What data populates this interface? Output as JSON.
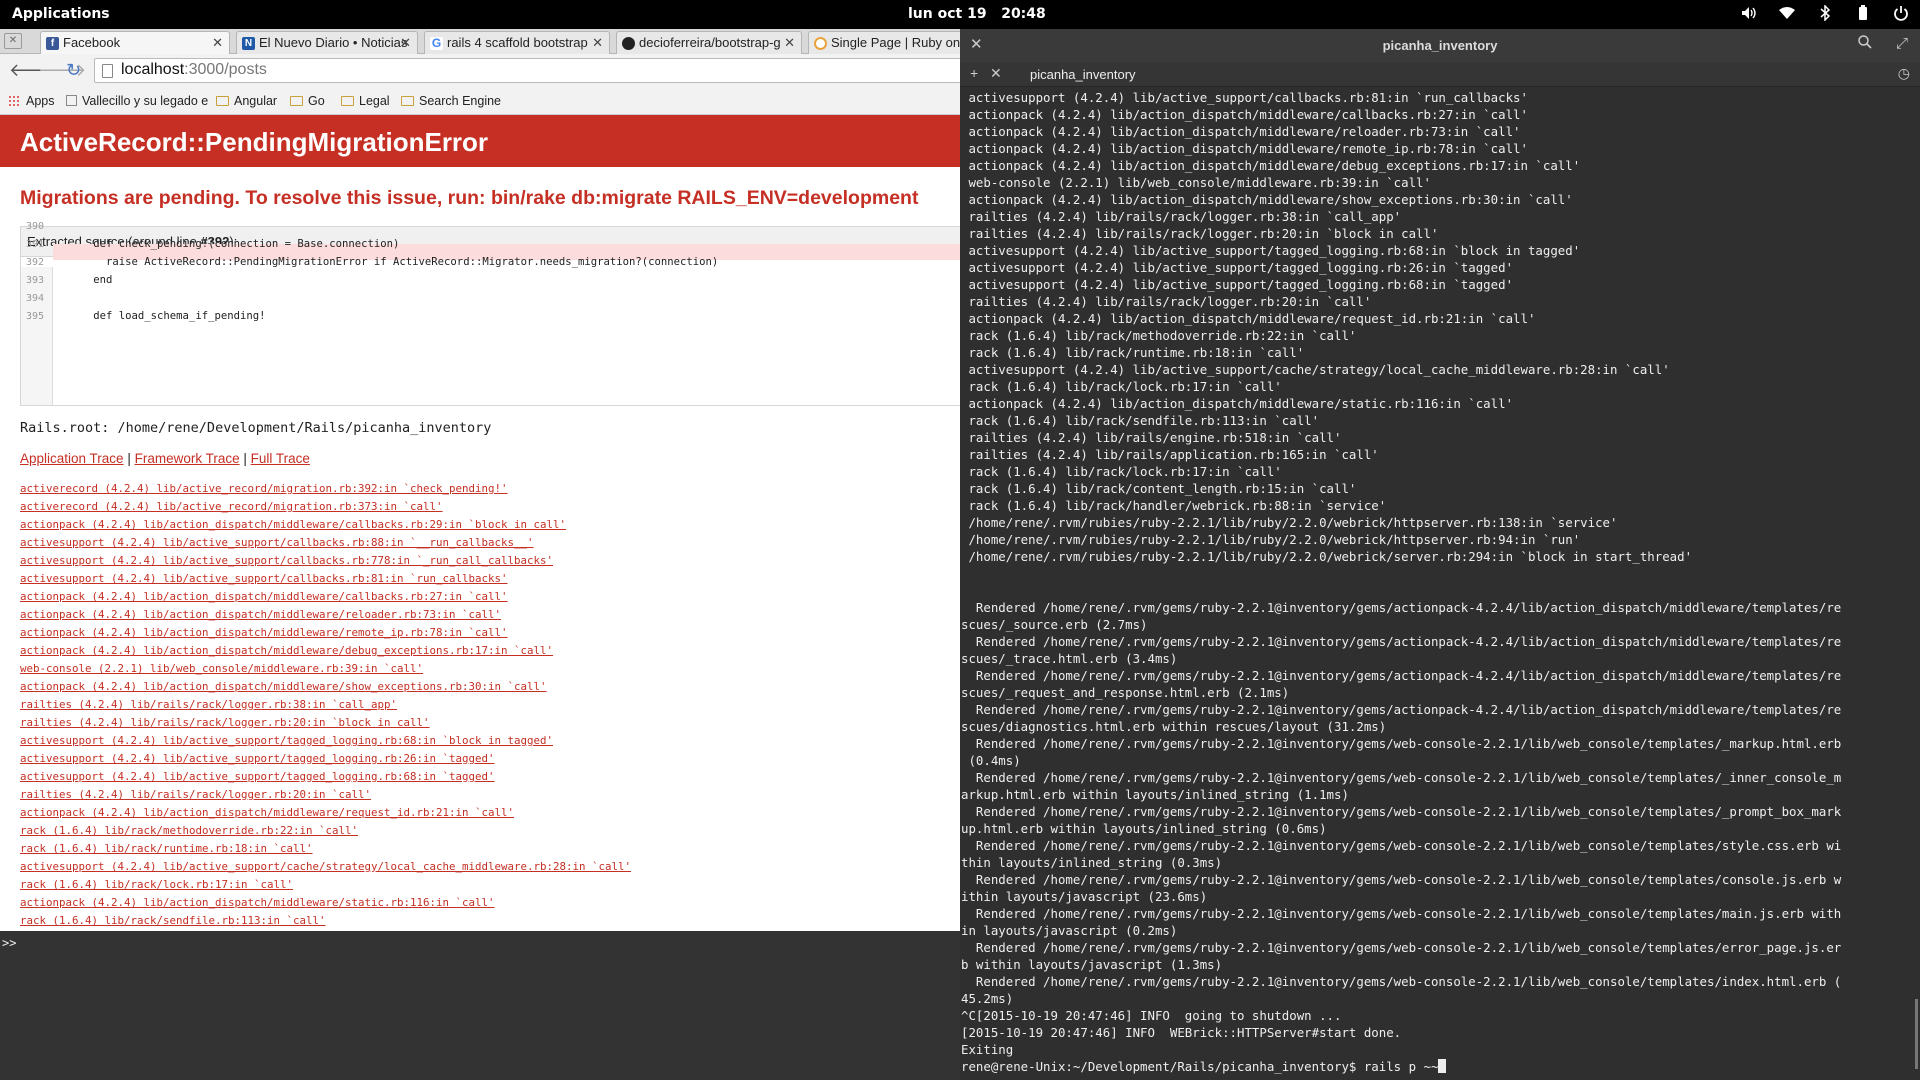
{
  "topbar": {
    "apps": "Applications",
    "date": "lun oct 19",
    "time": "20:48"
  },
  "browser": {
    "tabs": [
      {
        "label": "Facebook",
        "icon": "facebook-icon",
        "color": "#3b5998"
      },
      {
        "label": "El Nuevo Diario • Noticias",
        "icon": "news-icon",
        "color": "#1e5aa8"
      },
      {
        "label": "rails 4 scaffold bootstrap",
        "icon": "google-icon",
        "color": "#4285f4"
      },
      {
        "label": "decioferreira/bootstrap-g",
        "icon": "github-icon",
        "color": "#222222"
      },
      {
        "label": "Single Page | Ruby on R",
        "icon": "page-icon",
        "color": "#e8a33d"
      }
    ],
    "url_host": "localhost",
    "url_path": ":3000/posts",
    "bookmarks": [
      "Apps",
      "Vallecillo y su legado e",
      "Angular",
      "Go",
      "Legal",
      "Search Engine"
    ],
    "error_title": "ActiveRecord::PendingMigrationError",
    "error_message": "Migrations are pending. To resolve this issue, run: bin/rake db:migrate RAILS_ENV=development",
    "source_head_prefix": "Extracted source (around line ",
    "source_head_line": "#392",
    "source_head_suffix": "):",
    "source_line_numbers": [
      "390",
      "391",
      "392",
      "393",
      "394",
      "395"
    ],
    "source_lines": [
      "",
      "      def check_pending!(connection = Base.connection)",
      "        raise ActiveRecord::PendingMigrationError if ActiveRecord::Migrator.needs_migration?(connection)",
      "      end",
      "",
      "      def load_schema_if_pending!"
    ],
    "rails_root": "Rails.root: /home/rene/Development/Rails/picanha_inventory",
    "trace_links": [
      "Application Trace",
      "Framework Trace",
      "Full Trace"
    ],
    "trace_separator": " | ",
    "trace": [
      "activerecord (4.2.4) lib/active_record/migration.rb:392:in `check_pending!'",
      "activerecord (4.2.4) lib/active_record/migration.rb:373:in `call'",
      "actionpack (4.2.4) lib/action_dispatch/middleware/callbacks.rb:29:in `block in call'",
      "activesupport (4.2.4) lib/active_support/callbacks.rb:88:in `__run_callbacks__'",
      "activesupport (4.2.4) lib/active_support/callbacks.rb:778:in `_run_call_callbacks'",
      "activesupport (4.2.4) lib/active_support/callbacks.rb:81:in `run_callbacks'",
      "actionpack (4.2.4) lib/action_dispatch/middleware/callbacks.rb:27:in `call'",
      "actionpack (4.2.4) lib/action_dispatch/middleware/reloader.rb:73:in `call'",
      "actionpack (4.2.4) lib/action_dispatch/middleware/remote_ip.rb:78:in `call'",
      "actionpack (4.2.4) lib/action_dispatch/middleware/debug_exceptions.rb:17:in `call'",
      "web-console (2.2.1) lib/web_console/middleware.rb:39:in `call'",
      "actionpack (4.2.4) lib/action_dispatch/middleware/show_exceptions.rb:30:in `call'",
      "railties (4.2.4) lib/rails/rack/logger.rb:38:in `call_app'",
      "railties (4.2.4) lib/rails/rack/logger.rb:20:in `block in call'",
      "activesupport (4.2.4) lib/active_support/tagged_logging.rb:68:in `block in tagged'",
      "activesupport (4.2.4) lib/active_support/tagged_logging.rb:26:in `tagged'",
      "activesupport (4.2.4) lib/active_support/tagged_logging.rb:68:in `tagged'",
      "railties (4.2.4) lib/rails/rack/logger.rb:20:in `call'",
      "actionpack (4.2.4) lib/action_dispatch/middleware/request_id.rb:21:in `call'",
      "rack (1.6.4) lib/rack/methodoverride.rb:22:in `call'",
      "rack (1.6.4) lib/rack/runtime.rb:18:in `call'",
      "activesupport (4.2.4) lib/active_support/cache/strategy/local_cache_middleware.rb:28:in `call'",
      "rack (1.6.4) lib/rack/lock.rb:17:in `call'",
      "actionpack (4.2.4) lib/action_dispatch/middleware/static.rb:116:in `call'",
      "rack (1.6.4) lib/rack/sendfile.rb:113:in `call'"
    ],
    "console_prompt": ">>"
  },
  "terminal": {
    "title": "picanha_inventory",
    "tab_label": "picanha_inventory",
    "lines": [
      " activesupport (4.2.4) lib/active_support/callbacks.rb:81:in `run_callbacks'",
      " actionpack (4.2.4) lib/action_dispatch/middleware/callbacks.rb:27:in `call'",
      " actionpack (4.2.4) lib/action_dispatch/middleware/reloader.rb:73:in `call'",
      " actionpack (4.2.4) lib/action_dispatch/middleware/remote_ip.rb:78:in `call'",
      " actionpack (4.2.4) lib/action_dispatch/middleware/debug_exceptions.rb:17:in `call'",
      " web-console (2.2.1) lib/web_console/middleware.rb:39:in `call'",
      " actionpack (4.2.4) lib/action_dispatch/middleware/show_exceptions.rb:30:in `call'",
      " railties (4.2.4) lib/rails/rack/logger.rb:38:in `call_app'",
      " railties (4.2.4) lib/rails/rack/logger.rb:20:in `block in call'",
      " activesupport (4.2.4) lib/active_support/tagged_logging.rb:68:in `block in tagged'",
      " activesupport (4.2.4) lib/active_support/tagged_logging.rb:26:in `tagged'",
      " activesupport (4.2.4) lib/active_support/tagged_logging.rb:68:in `tagged'",
      " railties (4.2.4) lib/rails/rack/logger.rb:20:in `call'",
      " actionpack (4.2.4) lib/action_dispatch/middleware/request_id.rb:21:in `call'",
      " rack (1.6.4) lib/rack/methodoverride.rb:22:in `call'",
      " rack (1.6.4) lib/rack/runtime.rb:18:in `call'",
      " activesupport (4.2.4) lib/active_support/cache/strategy/local_cache_middleware.rb:28:in `call'",
      " rack (1.6.4) lib/rack/lock.rb:17:in `call'",
      " actionpack (4.2.4) lib/action_dispatch/middleware/static.rb:116:in `call'",
      " rack (1.6.4) lib/rack/sendfile.rb:113:in `call'",
      " railties (4.2.4) lib/rails/engine.rb:518:in `call'",
      " railties (4.2.4) lib/rails/application.rb:165:in `call'",
      " rack (1.6.4) lib/rack/lock.rb:17:in `call'",
      " rack (1.6.4) lib/rack/content_length.rb:15:in `call'",
      " rack (1.6.4) lib/rack/handler/webrick.rb:88:in `service'",
      " /home/rene/.rvm/rubies/ruby-2.2.1/lib/ruby/2.2.0/webrick/httpserver.rb:138:in `service'",
      " /home/rene/.rvm/rubies/ruby-2.2.1/lib/ruby/2.2.0/webrick/httpserver.rb:94:in `run'",
      " /home/rene/.rvm/rubies/ruby-2.2.1/lib/ruby/2.2.0/webrick/server.rb:294:in `block in start_thread'",
      "",
      "",
      "  Rendered /home/rene/.rvm/gems/ruby-2.2.1@inventory/gems/actionpack-4.2.4/lib/action_dispatch/middleware/templates/re",
      "scues/_source.erb (2.7ms)",
      "  Rendered /home/rene/.rvm/gems/ruby-2.2.1@inventory/gems/actionpack-4.2.4/lib/action_dispatch/middleware/templates/re",
      "scues/_trace.html.erb (3.4ms)",
      "  Rendered /home/rene/.rvm/gems/ruby-2.2.1@inventory/gems/actionpack-4.2.4/lib/action_dispatch/middleware/templates/re",
      "scues/_request_and_response.html.erb (2.1ms)",
      "  Rendered /home/rene/.rvm/gems/ruby-2.2.1@inventory/gems/actionpack-4.2.4/lib/action_dispatch/middleware/templates/re",
      "scues/diagnostics.html.erb within rescues/layout (31.2ms)",
      "  Rendered /home/rene/.rvm/gems/ruby-2.2.1@inventory/gems/web-console-2.2.1/lib/web_console/templates/_markup.html.erb",
      " (0.4ms)",
      "  Rendered /home/rene/.rvm/gems/ruby-2.2.1@inventory/gems/web-console-2.2.1/lib/web_console/templates/_inner_console_m",
      "arkup.html.erb within layouts/inlined_string (1.1ms)",
      "  Rendered /home/rene/.rvm/gems/ruby-2.2.1@inventory/gems/web-console-2.2.1/lib/web_console/templates/_prompt_box_mark",
      "up.html.erb within layouts/inlined_string (0.6ms)",
      "  Rendered /home/rene/.rvm/gems/ruby-2.2.1@inventory/gems/web-console-2.2.1/lib/web_console/templates/style.css.erb wi",
      "thin layouts/inlined_string (0.3ms)",
      "  Rendered /home/rene/.rvm/gems/ruby-2.2.1@inventory/gems/web-console-2.2.1/lib/web_console/templates/console.js.erb w",
      "ithin layouts/javascript (23.6ms)",
      "  Rendered /home/rene/.rvm/gems/ruby-2.2.1@inventory/gems/web-console-2.2.1/lib/web_console/templates/main.js.erb with",
      "in layouts/javascript (0.2ms)",
      "  Rendered /home/rene/.rvm/gems/ruby-2.2.1@inventory/gems/web-console-2.2.1/lib/web_console/templates/error_page.js.er",
      "b within layouts/javascript (1.3ms)",
      "  Rendered /home/rene/.rvm/gems/ruby-2.2.1@inventory/gems/web-console-2.2.1/lib/web_console/templates/index.html.erb (",
      "45.2ms)",
      "^C[2015-10-19 20:47:46] INFO  going to shutdown ...",
      "[2015-10-19 20:47:46] INFO  WEBrick::HTTPServer#start done.",
      "Exiting"
    ],
    "prompt": "rene@rene-Unix:~/Development/Rails/picanha_inventory$ rails p ~~"
  }
}
